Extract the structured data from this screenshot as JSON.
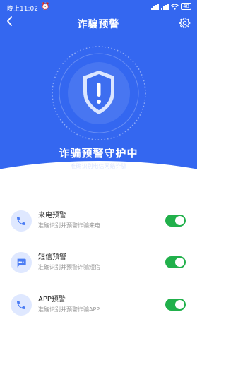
{
  "status_bar": {
    "time": "晚上11:02",
    "battery": "48"
  },
  "header": {
    "title": "诈骗预警"
  },
  "hero": {
    "status": "诈骗预警守护中",
    "subtitle": "准确识别电信网络诈骗"
  },
  "features": [
    {
      "title": "来电预警",
      "description": "准确识别并预警诈骗来电",
      "icon": "phone-icon",
      "enabled": true
    },
    {
      "title": "短信预警",
      "description": "准确识别并预警诈骗短信",
      "icon": "message-icon",
      "enabled": true
    },
    {
      "title": "APP预警",
      "description": "准确识别并预警诈骗APP",
      "icon": "phone-icon",
      "enabled": true
    }
  ],
  "colors": {
    "primary": "#3467f0",
    "toggle_on": "#21b04b",
    "icon_bg": "#dfe8ff",
    "icon_fg": "#4a7cf4"
  }
}
